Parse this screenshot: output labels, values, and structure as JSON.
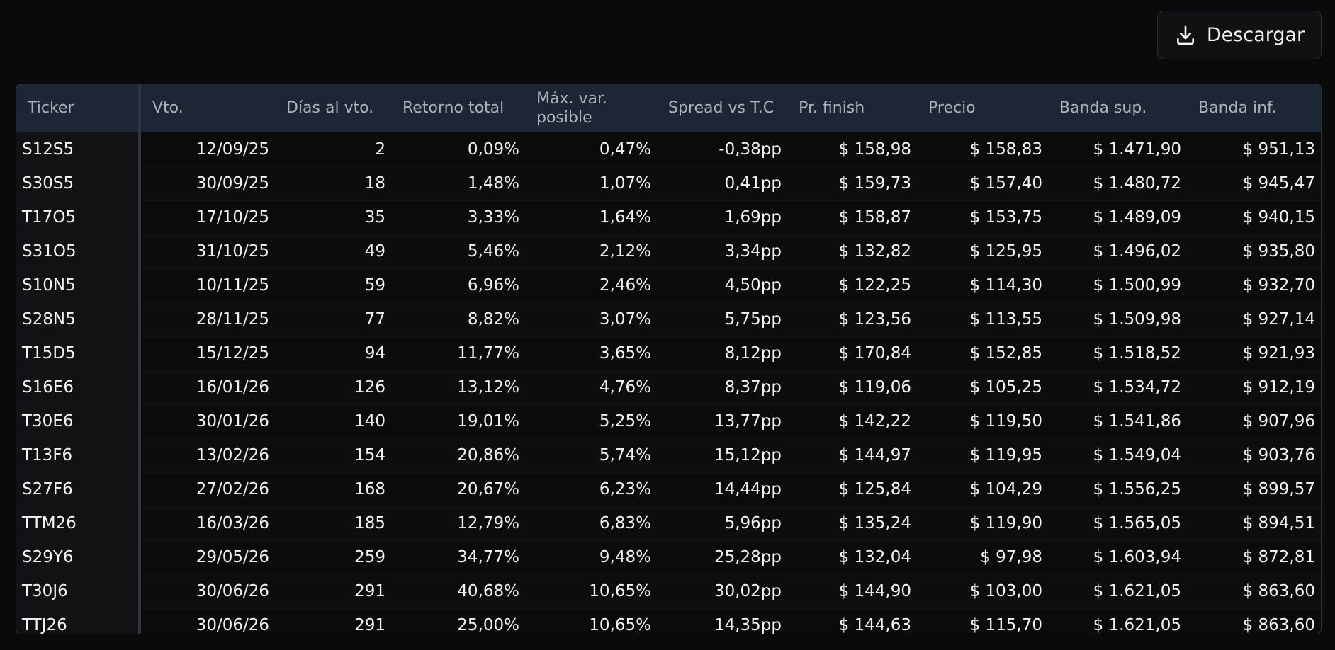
{
  "toolbar": {
    "download_label": "Descargar",
    "download_icon": "download-icon"
  },
  "table": {
    "columns": [
      "Ticker",
      "Vto.",
      "Días al vto.",
      "Retorno total",
      "Máx. var. posible",
      "Spread vs T.C",
      "Pr. finish",
      "Precio",
      "Banda sup.",
      "Banda inf."
    ],
    "rows": [
      [
        "S12S5",
        "12/09/25",
        "2",
        "0,09%",
        "0,47%",
        "-0,38pp",
        "$ 158,98",
        "$ 158,83",
        "$ 1.471,90",
        "$ 951,13"
      ],
      [
        "S30S5",
        "30/09/25",
        "18",
        "1,48%",
        "1,07%",
        "0,41pp",
        "$ 159,73",
        "$ 157,40",
        "$ 1.480,72",
        "$ 945,47"
      ],
      [
        "T17O5",
        "17/10/25",
        "35",
        "3,33%",
        "1,64%",
        "1,69pp",
        "$ 158,87",
        "$ 153,75",
        "$ 1.489,09",
        "$ 940,15"
      ],
      [
        "S31O5",
        "31/10/25",
        "49",
        "5,46%",
        "2,12%",
        "3,34pp",
        "$ 132,82",
        "$ 125,95",
        "$ 1.496,02",
        "$ 935,80"
      ],
      [
        "S10N5",
        "10/11/25",
        "59",
        "6,96%",
        "2,46%",
        "4,50pp",
        "$ 122,25",
        "$ 114,30",
        "$ 1.500,99",
        "$ 932,70"
      ],
      [
        "S28N5",
        "28/11/25",
        "77",
        "8,82%",
        "3,07%",
        "5,75pp",
        "$ 123,56",
        "$ 113,55",
        "$ 1.509,98",
        "$ 927,14"
      ],
      [
        "T15D5",
        "15/12/25",
        "94",
        "11,77%",
        "3,65%",
        "8,12pp",
        "$ 170,84",
        "$ 152,85",
        "$ 1.518,52",
        "$ 921,93"
      ],
      [
        "S16E6",
        "16/01/26",
        "126",
        "13,12%",
        "4,76%",
        "8,37pp",
        "$ 119,06",
        "$ 105,25",
        "$ 1.534,72",
        "$ 912,19"
      ],
      [
        "T30E6",
        "30/01/26",
        "140",
        "19,01%",
        "5,25%",
        "13,77pp",
        "$ 142,22",
        "$ 119,50",
        "$ 1.541,86",
        "$ 907,96"
      ],
      [
        "T13F6",
        "13/02/26",
        "154",
        "20,86%",
        "5,74%",
        "15,12pp",
        "$ 144,97",
        "$ 119,95",
        "$ 1.549,04",
        "$ 903,76"
      ],
      [
        "S27F6",
        "27/02/26",
        "168",
        "20,67%",
        "6,23%",
        "14,44pp",
        "$ 125,84",
        "$ 104,29",
        "$ 1.556,25",
        "$ 899,57"
      ],
      [
        "TTM26",
        "16/03/26",
        "185",
        "12,79%",
        "6,83%",
        "5,96pp",
        "$ 135,24",
        "$ 119,90",
        "$ 1.565,05",
        "$ 894,51"
      ],
      [
        "S29Y6",
        "29/05/26",
        "259",
        "34,77%",
        "9,48%",
        "25,28pp",
        "$ 132,04",
        "$ 97,98",
        "$ 1.603,94",
        "$ 872,81"
      ],
      [
        "T30J6",
        "30/06/26",
        "291",
        "40,68%",
        "10,65%",
        "30,02pp",
        "$ 144,90",
        "$ 103,00",
        "$ 1.621,05",
        "$ 863,60"
      ],
      [
        "TTJ26",
        "30/06/26",
        "291",
        "25,00%",
        "10,65%",
        "14,35pp",
        "$ 144,63",
        "$ 115,70",
        "$ 1.621,05",
        "$ 863,60"
      ]
    ]
  }
}
